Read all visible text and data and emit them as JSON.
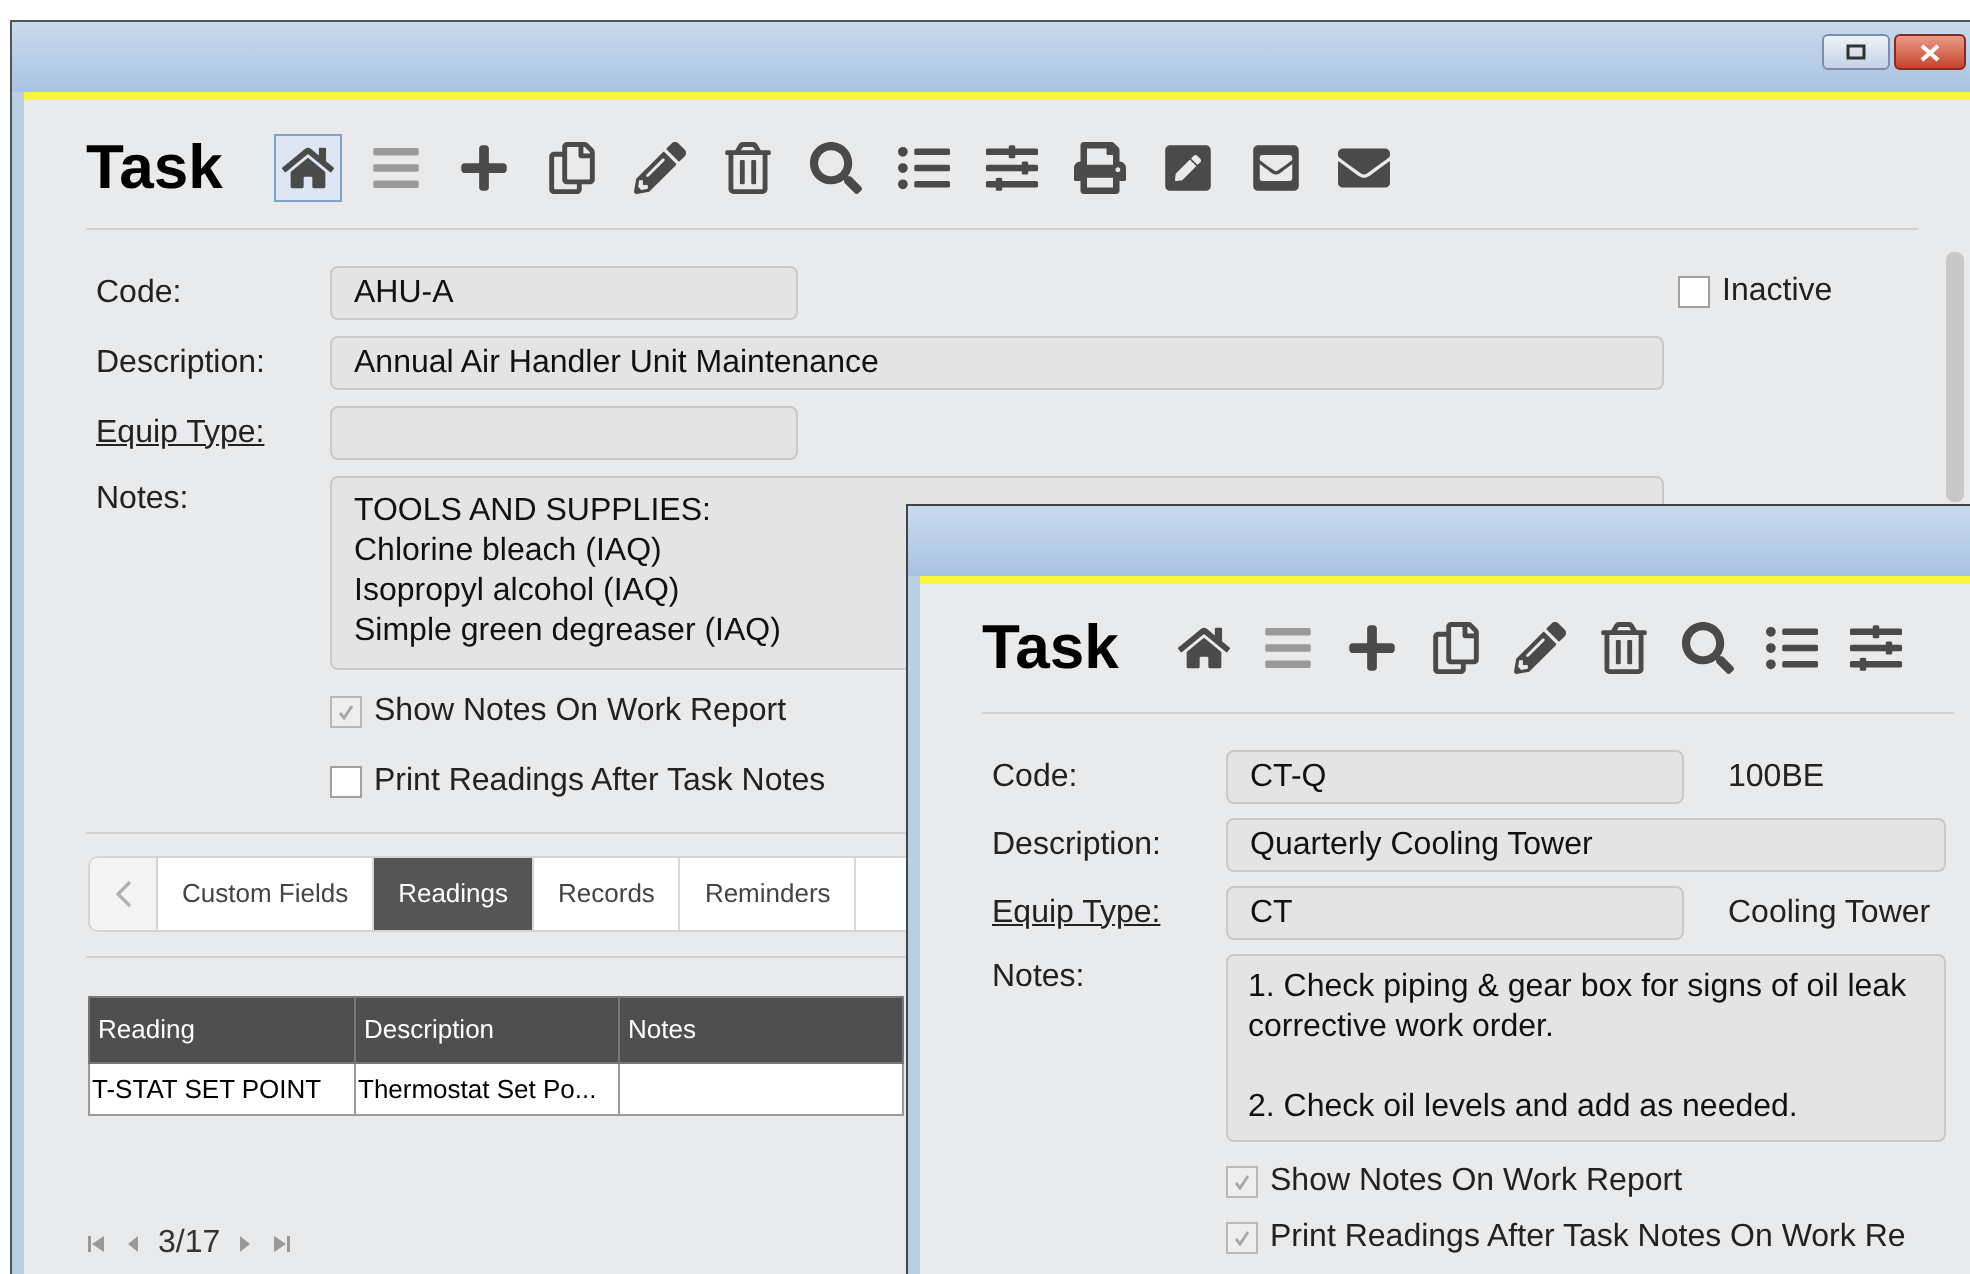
{
  "back_window": {
    "heading": "Task",
    "toolbar": [
      {
        "kind": "home",
        "selected": true
      },
      {
        "kind": "list",
        "selected": false
      },
      {
        "kind": "add",
        "selected": false
      },
      {
        "kind": "copy",
        "selected": false
      },
      {
        "kind": "edit",
        "selected": false
      },
      {
        "kind": "delete",
        "selected": false
      },
      {
        "kind": "search",
        "selected": false
      },
      {
        "kind": "list-save",
        "selected": false
      },
      {
        "kind": "sliders",
        "selected": false
      },
      {
        "kind": "print",
        "selected": false
      },
      {
        "kind": "edit-box",
        "selected": false
      },
      {
        "kind": "mail-box",
        "selected": false
      },
      {
        "kind": "mail",
        "selected": false
      }
    ],
    "fields": [
      {
        "label": "Code:",
        "value": "AHU-A",
        "link": false,
        "wide": false
      },
      {
        "label": "Description:",
        "value": "Annual Air Handler Unit Maintenance",
        "link": false,
        "wide": true
      },
      {
        "label": "Equip Type:",
        "link": true,
        "wide": false
      }
    ],
    "inactive": {
      "label": "Inactive",
      "checked": false
    },
    "notes": {
      "label": "Notes:",
      "lines": [
        "TOOLS AND SUPPLIES:",
        "Chlorine bleach (IAQ)",
        "Isopropyl alcohol (IAQ)",
        "Simple green degreaser (IAQ)"
      ]
    },
    "options": [
      {
        "label": "Show Notes On Work Report",
        "checked": true
      },
      {
        "label": "Print Readings After Task Notes",
        "checked": false
      }
    ],
    "tabs": [
      {
        "label": "Custom Fields",
        "selected": false
      },
      {
        "label": "Readings",
        "selected": true
      },
      {
        "label": "Records",
        "selected": false
      },
      {
        "label": "Reminders",
        "selected": false
      }
    ],
    "table": {
      "columns": [
        "Reading",
        "Description",
        "Notes"
      ],
      "rows": [
        [
          "T-STAT SET POINT",
          "Thermostat Set Po...",
          ""
        ]
      ]
    },
    "pager": "3/17"
  },
  "front_window": {
    "heading": "Task",
    "toolbar": [
      {
        "kind": "home",
        "selected": false
      },
      {
        "kind": "list",
        "selected": false
      },
      {
        "kind": "add",
        "selected": false
      },
      {
        "kind": "copy",
        "selected": false
      },
      {
        "kind": "edit",
        "selected": false
      },
      {
        "kind": "delete",
        "selected": false
      },
      {
        "kind": "search",
        "selected": false
      },
      {
        "kind": "list-save",
        "selected": false
      },
      {
        "kind": "sliders",
        "selected": false
      }
    ],
    "fields": [
      {
        "label": "Code:",
        "value": "CT-Q",
        "link": false,
        "wide": false,
        "extra": "100BE"
      },
      {
        "label": "Description:",
        "value": "Quarterly Cooling Tower",
        "link": false,
        "wide": true
      },
      {
        "label": "Equip Type:",
        "value": "CT",
        "link": true,
        "wide": false,
        "extra": "Cooling Tower"
      }
    ],
    "notes": {
      "label": "Notes:",
      "paragraphs": [
        [
          "1. Check piping & gear box for signs of oil leak",
          "corrective work order."
        ],
        [
          "2. Check oil levels and add as needed."
        ]
      ]
    },
    "options": [
      {
        "label": "Show Notes On Work Report",
        "checked": true
      },
      {
        "label": "Print Readings After Task Notes On Work Re",
        "checked": true
      }
    ]
  }
}
